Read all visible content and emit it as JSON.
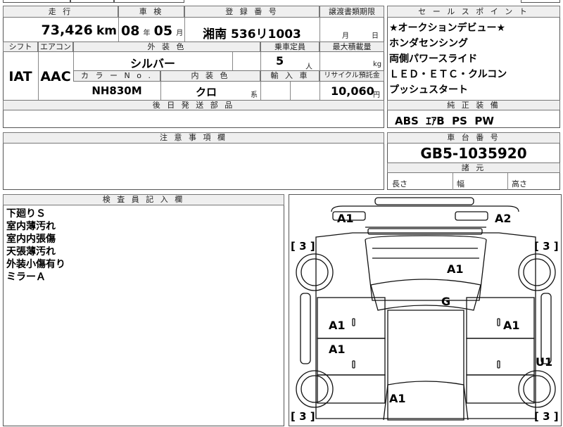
{
  "vehicle": {
    "mileage_label": "走 行",
    "mileage_value": "73,426",
    "mileage_unit": "km",
    "inspection_label": "車 検",
    "inspection_year": "08",
    "inspection_year_unit": "年",
    "inspection_month": "05",
    "inspection_month_unit": "月",
    "registration_label": "登 録 番 号",
    "registration_value": "湘南 536リ1003",
    "transfer_label": "譲渡書類期限",
    "transfer_month_unit": "月",
    "transfer_day_unit": "日",
    "shift_label": "シフト",
    "shift_value": "IAT",
    "ac_label": "エアコン",
    "ac_value": "AAC",
    "exterior_label": "外 装 色",
    "exterior_value": "シルバー",
    "capacity_label": "乗車定員",
    "capacity_value": "5",
    "capacity_unit": "人",
    "load_label": "最大積載量",
    "load_unit": "kg",
    "color_no_label": "カ ラ ー N o .",
    "color_no_value": "NH830M",
    "interior_label": "内 装 色",
    "interior_value": "クロ",
    "interior_unit": "系",
    "import_label": "輸 入 車",
    "recycle_label": "リサイクル預託金",
    "recycle_value": "10,060",
    "recycle_unit": "円",
    "parts_label": "後 日 発 送 部 品"
  },
  "sales_points": {
    "header": "セ ー ル ス ポ イ ン ト",
    "lines": [
      "★オークションデビュー★",
      "ホンダセンシング",
      "両側パワースライド",
      "ＬＥＤ・ＥＴＣ・クルコン",
      "プッシュスタート"
    ]
  },
  "equipment": {
    "header": "純 正 装 備",
    "value": "ABS  ｴｱB  PS  PW"
  },
  "caution": {
    "header": "注 意 事 項 欄"
  },
  "chassis": {
    "header": "車 台 番 号",
    "value": "GB5-1035920",
    "dims_header": "諸 元",
    "length_label": "長さ",
    "width_label": "幅",
    "height_label": "高さ"
  },
  "inspector": {
    "header": "検 査 員 記 入 欄",
    "lines": [
      "下廻りＳ",
      "室内薄汚れ",
      "室内内張傷",
      "天張薄汚れ",
      "外装小傷有り",
      "ミラーＡ"
    ]
  },
  "diagram": {
    "marks": {
      "front_left_corner": "A1",
      "front_right_corner": "A2",
      "hood": "A1",
      "windshield": "G",
      "front_left_door": "A1",
      "front_right_door": "A1",
      "rear_left_door": "A1",
      "right_rocker": "U1",
      "rear_center": "A1"
    },
    "tires": {
      "front_left": "[ 3 ]",
      "front_right": "[ 3 ]",
      "rear_left": "[ 3 ]",
      "rear_right": "[ 3 ]"
    }
  }
}
